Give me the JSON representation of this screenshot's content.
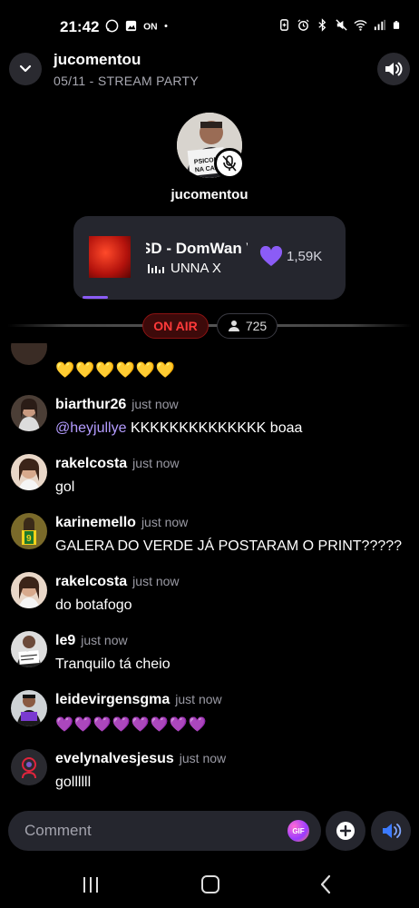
{
  "status_bar": {
    "time": "21:42",
    "left_icons": [
      "whatsapp-icon",
      "image-icon",
      "on-icon",
      "dot-icon"
    ],
    "right_icons": [
      "battery-saver-icon",
      "alarm-icon",
      "bluetooth-icon",
      "mute-icon",
      "wifi-icon",
      "signal-icon",
      "battery-icon"
    ]
  },
  "header": {
    "title": "jucomentou",
    "subtitle": "05/11 - STREAM PARTY"
  },
  "host": {
    "name": "jucomentou",
    "sign_text_1": "PSICOLL",
    "sign_text_2": "NA CARI"
  },
  "now_playing": {
    "track": "SD - DomWan V",
    "artist": "UNNA X",
    "likes": "1,59K",
    "progress": 0.1
  },
  "live": {
    "on_air_label": "ON AIR",
    "viewers": "725"
  },
  "chat": {
    "partial_message": "💛💛💛💛💛💛",
    "messages": [
      {
        "user": "biarthur26",
        "time": "just now",
        "mention": "@heyjullye",
        "text": " KKKKKKKKKKKKKK boaa"
      },
      {
        "user": "rakelcosta",
        "time": "just now",
        "mention": "",
        "text": "gol"
      },
      {
        "user": "karinemello",
        "time": "just now",
        "mention": "",
        "text": "GALERA DO VERDE JÁ POSTARAM O PRINT?????"
      },
      {
        "user": "rakelcosta",
        "time": "just now",
        "mention": "",
        "text": "do botafogo"
      },
      {
        "user": "le9",
        "time": "just now",
        "mention": "",
        "text": "Tranquilo tá cheio"
      },
      {
        "user": "leidevirgensgma",
        "time": "just now",
        "mention": "",
        "text": "💜💜💜💜💜💜💜💜"
      },
      {
        "user": "evelynalvesjesus",
        "time": "just now",
        "mention": "",
        "text": "gollllll"
      }
    ]
  },
  "composer": {
    "placeholder": "Comment",
    "gif_label": "GIF"
  },
  "colors": {
    "accent": "#8b5cf6",
    "on_air": "#ff3a3a",
    "mention": "#b49cff",
    "card_bg": "#25262e"
  }
}
